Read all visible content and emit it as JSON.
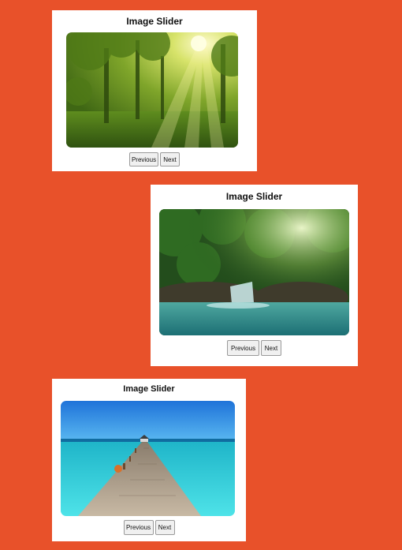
{
  "page": {
    "background_color": "#e8512a"
  },
  "sliders": [
    {
      "title": "Image Slider",
      "image_subject": "forest-sunbeams-photo",
      "previous_label": "Previous",
      "next_label": "Next"
    },
    {
      "title": "Image Slider",
      "image_subject": "jungle-waterfall-photo",
      "previous_label": "Previous",
      "next_label": "Next"
    },
    {
      "title": "Image Slider",
      "image_subject": "tropical-pier-photo",
      "previous_label": "Previous",
      "next_label": "Next"
    }
  ]
}
